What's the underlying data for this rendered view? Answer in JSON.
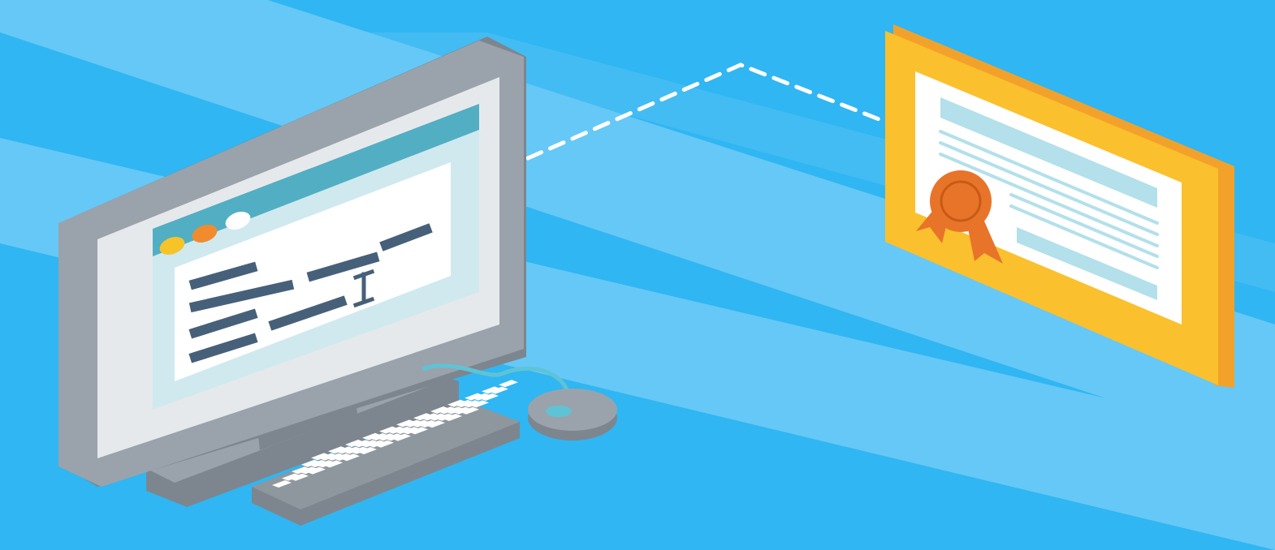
{
  "illustration": {
    "subject": "computer-to-certificate",
    "text_labels": []
  },
  "colors": {
    "background": "#30b6f2",
    "stripe_light": "#66c8f6",
    "monitor_frame": "#9aa3ab",
    "monitor_frame_shadow": "#7d868e",
    "monitor_bezel": "#e6e9ec",
    "browser_bar": "#52aec3",
    "browser_content": "#ffffff",
    "text_lines": "#47607a",
    "window_dot_yellow": "#f6c429",
    "window_dot_orange": "#f28b2e",
    "window_dot_white": "#ffffff",
    "keyboard_base": "#8f979e",
    "keyboard_keys": "#ffffff",
    "mouse_body": "#9aa3ab",
    "mouse_button": "#5fc3d6",
    "cable": "#5fc3d6",
    "connector_dash": "#ffffff",
    "certificate_frame": "#fbc02d",
    "certificate_edge": "#f2a22a",
    "certificate_paper": "#ffffff",
    "certificate_lines": "#b3e0ea",
    "ribbon_rosette": "#e8742a",
    "ribbon_tails": "#e8742a"
  },
  "icons": {
    "cursor": "text-cursor-icon",
    "ribbon": "award-ribbon-icon"
  }
}
